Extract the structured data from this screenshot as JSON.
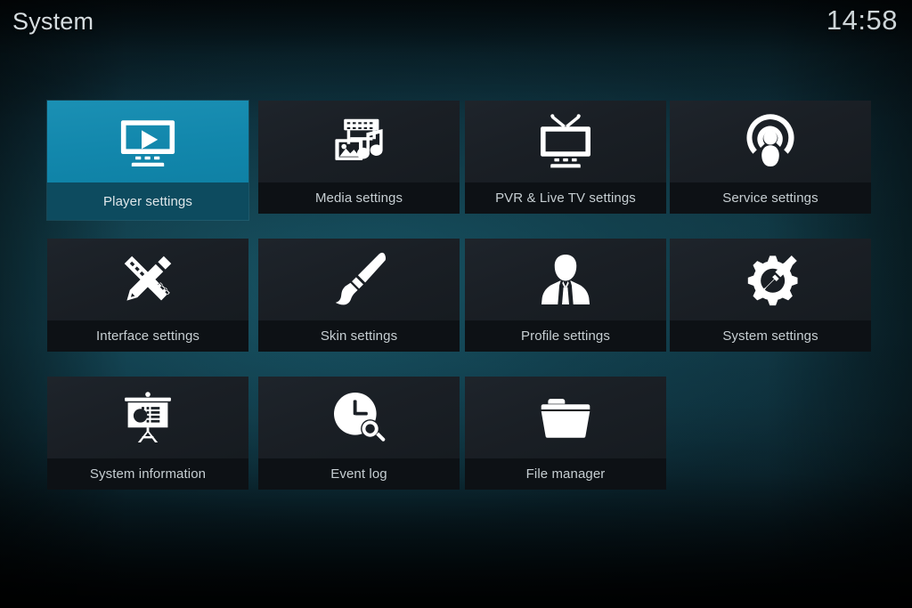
{
  "header": {
    "title": "System",
    "clock": "14:58"
  },
  "grid": {
    "rows": [
      [
        {
          "label": "Player settings",
          "icon": "monitor-play-icon",
          "selected": true
        },
        {
          "label": "Media settings",
          "icon": "media-library-icon",
          "selected": false
        },
        {
          "label": "PVR & Live TV settings",
          "icon": "tv-antenna-icon",
          "selected": false
        },
        {
          "label": "Service settings",
          "icon": "broadcast-user-icon",
          "selected": false
        }
      ],
      [
        {
          "label": "Interface settings",
          "icon": "pencil-ruler-icon",
          "selected": false
        },
        {
          "label": "Skin settings",
          "icon": "paintbrush-icon",
          "selected": false
        },
        {
          "label": "Profile settings",
          "icon": "person-bust-icon",
          "selected": false
        },
        {
          "label": "System settings",
          "icon": "gear-screwdriver-icon",
          "selected": false
        }
      ],
      [
        {
          "label": "System information",
          "icon": "presentation-chart-icon",
          "selected": false
        },
        {
          "label": "Event log",
          "icon": "clock-search-icon",
          "selected": false
        },
        {
          "label": "File manager",
          "icon": "folder-icon",
          "selected": false
        }
      ]
    ]
  },
  "colors": {
    "accent": "#1287ac",
    "accent_label": "#0d4b5f",
    "tile_bg": "#1b2026",
    "tile_label_bg": "#0d1115",
    "text": "#c6ced2",
    "background_teal": "#113440"
  }
}
